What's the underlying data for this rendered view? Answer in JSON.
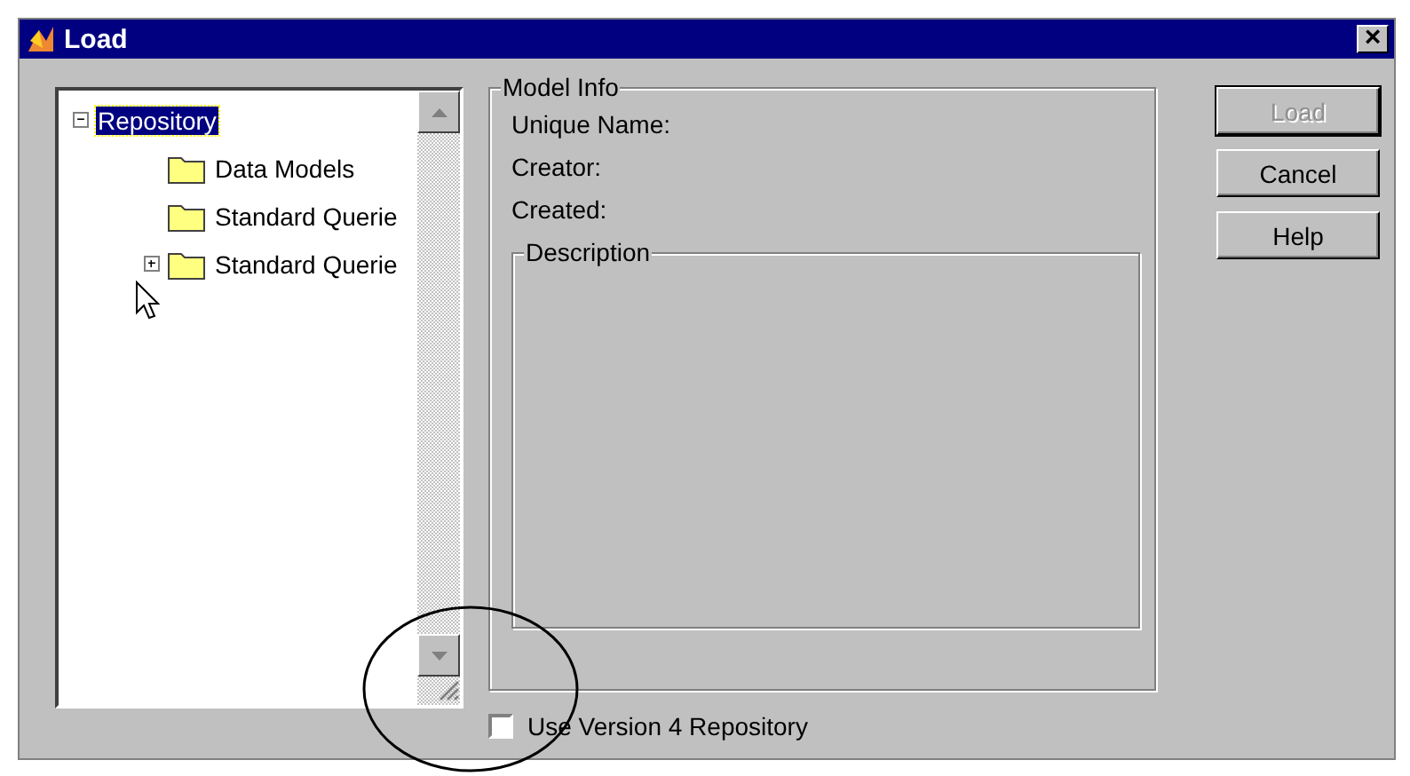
{
  "window": {
    "title": "Load",
    "close": "×"
  },
  "tree": [
    {
      "label": "Repository",
      "selected": true,
      "expanded": true,
      "children": [
        {
          "label": "Data Models",
          "selected": false,
          "expanded": false
        },
        {
          "label": "Standard Querie",
          "selected": false,
          "expanded": false
        },
        {
          "label": "Standard Querie",
          "selected": false,
          "expanded": false,
          "collapsed_children": true
        }
      ]
    }
  ],
  "model_info": {
    "title": "Model Info",
    "fields": [
      "Unique Name:",
      "Creator:",
      "Created:"
    ],
    "description": {
      "title": "Description"
    }
  },
  "buttons": [
    {
      "label": "Load",
      "disabled": true
    },
    {
      "label": "Cancel",
      "disabled": false
    },
    {
      "label": "Help",
      "disabled": false
    }
  ],
  "option": {
    "label": "Use Version 4 Repository",
    "checked": false
  }
}
